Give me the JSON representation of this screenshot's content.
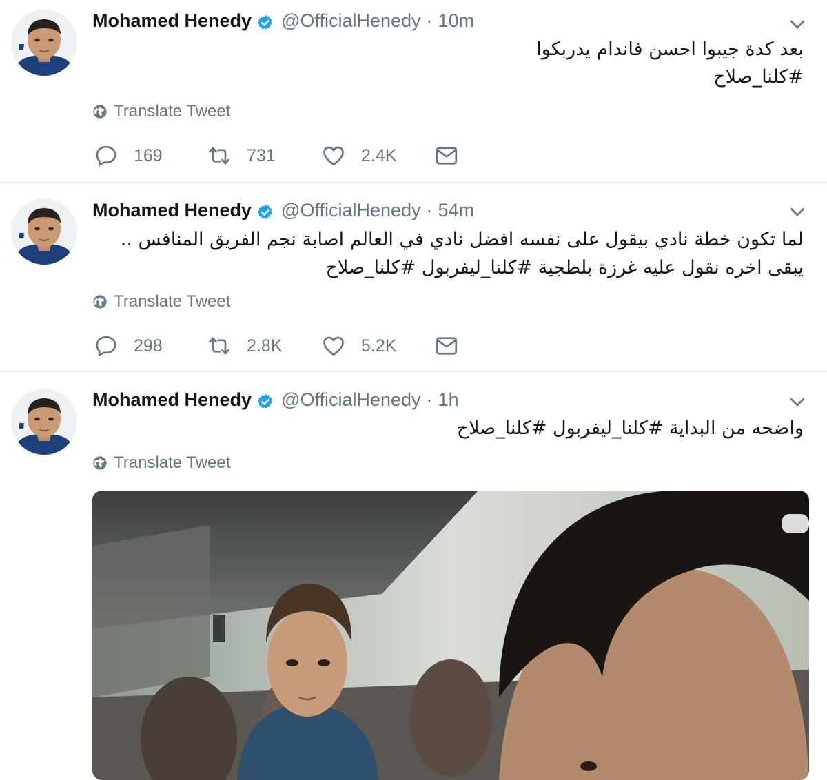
{
  "tweets": [
    {
      "name": "Mohamed Henedy",
      "handle": "@OfficialHenedy",
      "time": "10m",
      "lines": [
        "بعد كدة جيبوا احسن فاندام يدربكوا",
        "#كلنا_صلاح"
      ],
      "translate": "Translate Tweet",
      "replies": "169",
      "retweets": "731",
      "likes": "2.4K"
    },
    {
      "name": "Mohamed Henedy",
      "handle": "@OfficialHenedy",
      "time": "54m",
      "lines": [
        "لما تكون خطة نادي بيقول على نفسه افضل نادي في العالم اصابة نجم الفريق المنافس ..",
        "يبقى اخره نقول عليه غرزة بلطجية #كلنا_ليفربول #كلنا_صلاح"
      ],
      "translate": "Translate Tweet",
      "replies": "298",
      "retweets": "2.8K",
      "likes": "5.2K"
    },
    {
      "name": "Mohamed Henedy",
      "handle": "@OfficialHenedy",
      "time": "1h",
      "lines": [
        "واضحه من البداية #كلنا_ليفربول #كلنا_صلاح"
      ],
      "translate": "Translate Tweet"
    }
  ],
  "colors": {
    "verified": "#1da1f2",
    "muted": "#657786",
    "text": "#14171a",
    "border": "#e6ecf0"
  },
  "icons": [
    "verified-badge-icon",
    "chevron-down-icon",
    "globe-icon",
    "reply-icon",
    "retweet-icon",
    "like-icon",
    "direct-message-icon"
  ]
}
